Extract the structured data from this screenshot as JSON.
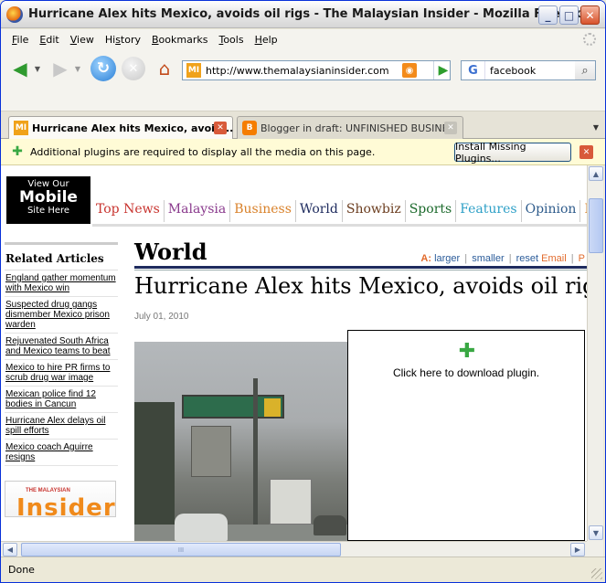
{
  "window": {
    "title": "Hurricane Alex hits Mexico, avoids oil rigs - The Malaysian Insider - Mozilla Firefox",
    "btn_minimize": "_",
    "btn_maximize": "□",
    "btn_close": "✕"
  },
  "menu": {
    "items": [
      {
        "key": "F",
        "rest": "ile"
      },
      {
        "key": "E",
        "rest": "dit"
      },
      {
        "key": "V",
        "rest": "iew"
      },
      {
        "pre": "Hi",
        "key": "s",
        "rest": "tory"
      },
      {
        "key": "B",
        "rest": "ookmarks"
      },
      {
        "key": "T",
        "rest": "ools"
      },
      {
        "key": "H",
        "rest": "elp"
      }
    ]
  },
  "nav": {
    "url": "http://www.themalaysianinsider.com/world",
    "site_icon": "MI",
    "search_engine": "G",
    "search_value": "facebook",
    "icons": {
      "back": "back-arrow-icon",
      "forward": "forward-arrow-icon",
      "reload": "reload-icon",
      "stop": "stop-icon",
      "home": "home-icon",
      "rss": "rss-feed-icon",
      "go": "go-arrow-icon",
      "search": "magnifier-icon"
    }
  },
  "tabs": [
    {
      "label": "Hurricane Alex hits Mexico, avoid...",
      "icon": "MI",
      "active": true
    },
    {
      "label": "Blogger in draft: UNFINISHED BUSINE...",
      "icon": "B",
      "active": false
    }
  ],
  "notification": {
    "text": "Additional plugins are required to display all the media on this page.",
    "button": "Install Missing Plugins..."
  },
  "page": {
    "mobile_badge": {
      "line1": "View Our",
      "line2": "Mobile",
      "line3": "Site Here"
    },
    "site_nav": [
      {
        "label": "Top News",
        "color": "#c8342f"
      },
      {
        "label": "Malaysia",
        "color": "#8a3a8d"
      },
      {
        "label": "Business",
        "color": "#d9822b"
      },
      {
        "label": "World",
        "color": "#1e2b5e"
      },
      {
        "label": "Showbiz",
        "color": "#6b3d1f"
      },
      {
        "label": "Sports",
        "color": "#1c6a2c"
      },
      {
        "label": "Features",
        "color": "#2ea0c7"
      },
      {
        "label": "Opinion",
        "color": "#2f5c8c"
      },
      {
        "label": "B",
        "color": "#d9822b"
      }
    ],
    "sidebar": {
      "title": "Related Articles",
      "items": [
        "England gather momentum with Mexico win",
        "Suspected drug gangs dismember Mexico prison warden",
        "Rejuvenated South Africa and Mexico teams to beat",
        "Mexico to hire PR firms to scrub drug war image",
        "Mexican police find 12 bodies in Cancun",
        "Hurricane Alex delays oil spill efforts",
        "Mexico coach Aguirre resigns"
      ],
      "logo_small": "THE MALAYSIAN",
      "logo_big": "Insider"
    },
    "section": "World",
    "tools": {
      "label": "A:",
      "larger": "larger",
      "smaller": "smaller",
      "reset": "reset",
      "email": "Email",
      "p": "P"
    },
    "article_title": "Hurricane Alex hits Mexico, avoids oil rigs",
    "article_date": "July 01, 2010",
    "plugin_text": "Click here to download plugin."
  },
  "status": "Done"
}
